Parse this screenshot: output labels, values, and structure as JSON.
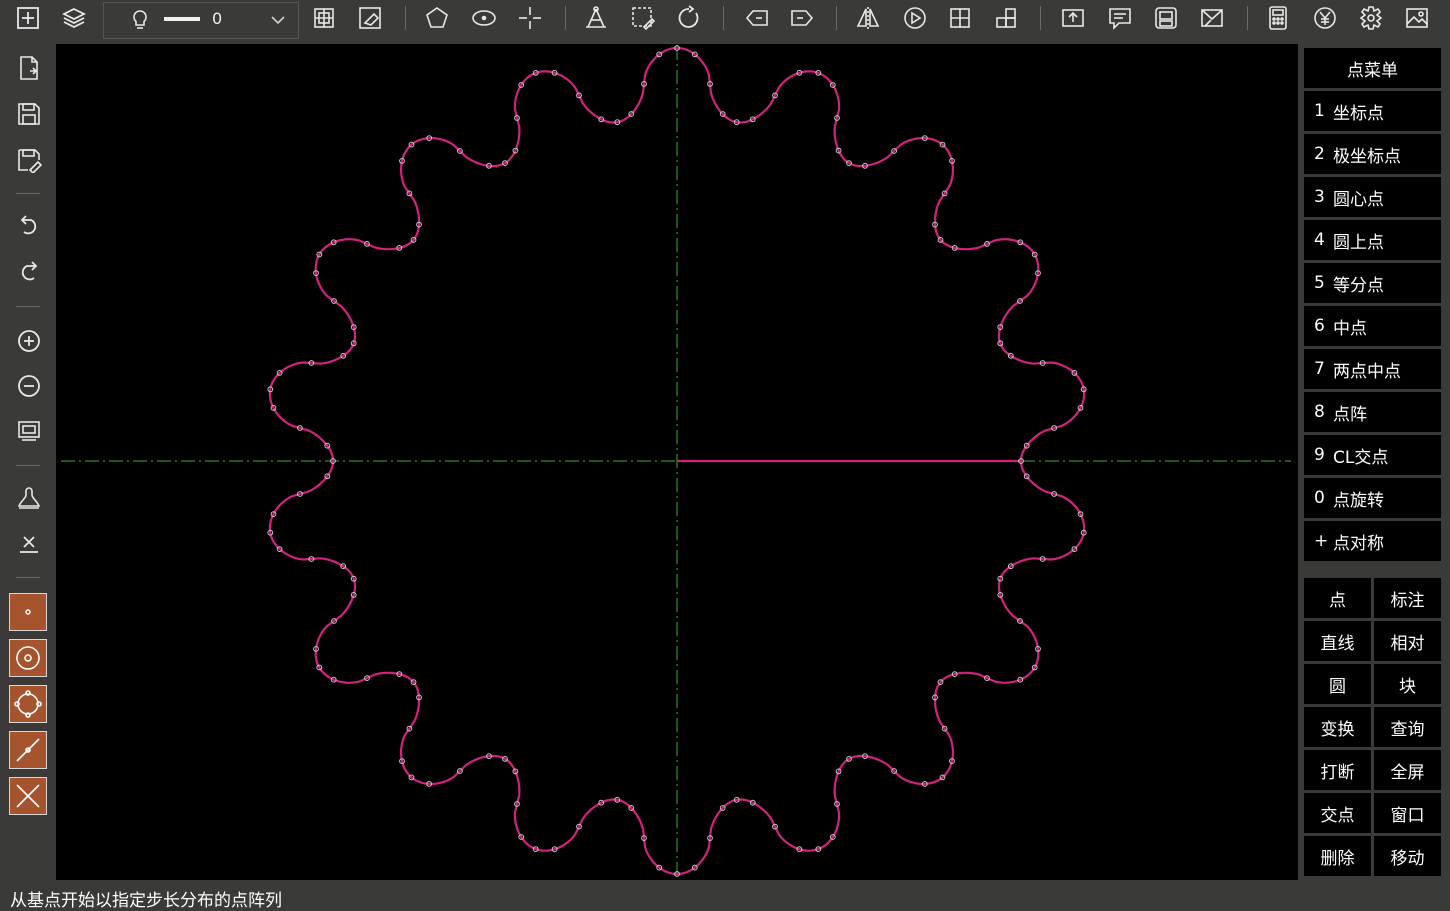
{
  "toolbar": {
    "layer_value": "0",
    "buttons": [
      "new-view-icon",
      "layers-icon",
      "grid-snap-icon",
      "eraser-icon",
      "polygon-icon",
      "ellipse-icon",
      "crosshair-icon",
      "measure-icon",
      "select-edit-icon",
      "rotate-icon",
      "tag-left-icon",
      "tag-right-icon",
      "mirror-icon",
      "play-icon",
      "grid-icon",
      "blocks-icon",
      "export-icon",
      "comment-icon",
      "print-icon",
      "mail-icon",
      "calculator-icon",
      "yen-icon",
      "settings-icon",
      "image-icon"
    ]
  },
  "left_toolbar": {
    "buttons": [
      "new-file-icon",
      "save-icon",
      "save-as-icon",
      "undo-icon",
      "redo-icon",
      "zoom-in-icon",
      "zoom-out-icon",
      "zoom-window-icon",
      "bell-icon",
      "clear-icon"
    ],
    "snap_buttons": [
      "snap-point-icon",
      "snap-center-icon",
      "snap-circle-icon",
      "snap-midline-icon",
      "snap-intersection-icon"
    ]
  },
  "point_menu": {
    "title": "点菜单",
    "items": [
      {
        "key": "1",
        "label": "坐标点"
      },
      {
        "key": "2",
        "label": "极坐标点"
      },
      {
        "key": "3",
        "label": "圆心点"
      },
      {
        "key": "4",
        "label": "圆上点"
      },
      {
        "key": "5",
        "label": "等分点"
      },
      {
        "key": "6",
        "label": "中点"
      },
      {
        "key": "7",
        "label": "两点中点"
      },
      {
        "key": "8",
        "label": "点阵"
      },
      {
        "key": "9",
        "label": "CL交点"
      },
      {
        "key": "0",
        "label": "点旋转"
      },
      {
        "key": "+",
        "label": "点对称"
      }
    ]
  },
  "function_grid": [
    [
      "点",
      "标注"
    ],
    [
      "直线",
      "相对"
    ],
    [
      "圆",
      "块"
    ],
    [
      "变换",
      "查询"
    ],
    [
      "打断",
      "全屏"
    ],
    [
      "交点",
      "窗口"
    ],
    [
      "删除",
      "移动"
    ]
  ],
  "drawing": {
    "teeth": 18,
    "line_color": "#d1237d",
    "axis_color": "#2e8b2e",
    "point_color": "#c8c8c8"
  },
  "status": {
    "text": "从基点开始以指定步长分布的点阵列"
  },
  "colors": {
    "ui_bg": "#3a3b38",
    "canvas_bg": "#000000",
    "snap_button": "#a6542d"
  }
}
